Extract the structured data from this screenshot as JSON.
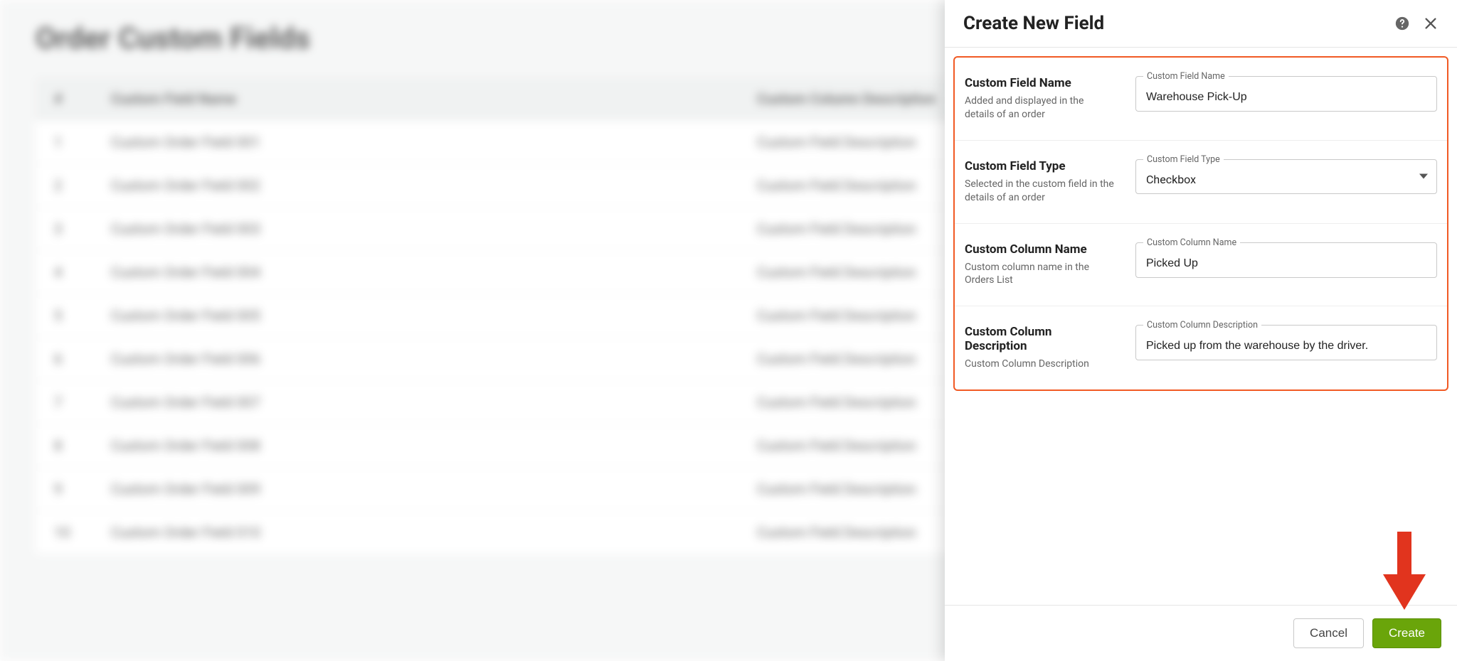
{
  "page": {
    "title": "Order Custom Fields",
    "columns": {
      "num": "#",
      "name": "Custom Field Name",
      "desc": "Custom Column Description"
    },
    "rows": [
      {
        "n": "1",
        "name": "Custom Order Field 001",
        "desc": "Custom Field Description"
      },
      {
        "n": "2",
        "name": "Custom Order Field 002",
        "desc": "Custom Field Description"
      },
      {
        "n": "3",
        "name": "Custom Order Field 003",
        "desc": "Custom Field Description"
      },
      {
        "n": "4",
        "name": "Custom Order Field 004",
        "desc": "Custom Field Description"
      },
      {
        "n": "5",
        "name": "Custom Order Field 005",
        "desc": "Custom Field Description"
      },
      {
        "n": "6",
        "name": "Custom Order Field 006",
        "desc": "Custom Field Description"
      },
      {
        "n": "7",
        "name": "Custom Order Field 007",
        "desc": "Custom Field Description"
      },
      {
        "n": "8",
        "name": "Custom Order Field 008",
        "desc": "Custom Field Description"
      },
      {
        "n": "9",
        "name": "Custom Order Field 009",
        "desc": "Custom Field Description"
      },
      {
        "n": "10",
        "name": "Custom Order Field 010",
        "desc": "Custom Field Description"
      }
    ]
  },
  "drawer": {
    "title": "Create New Field",
    "sections": {
      "field_name": {
        "title": "Custom Field Name",
        "desc": "Added and displayed in the details of an order",
        "input_label": "Custom Field Name",
        "value": "Warehouse Pick-Up"
      },
      "field_type": {
        "title": "Custom Field Type",
        "desc": "Selected in the custom field in the details of an order",
        "input_label": "Custom Field Type",
        "value": "Checkbox"
      },
      "col_name": {
        "title": "Custom Column Name",
        "desc": "Custom column name in the Orders List",
        "input_label": "Custom Column Name",
        "value": "Picked Up"
      },
      "col_desc": {
        "title": "Custom Column Description",
        "desc": "Custom Column Description",
        "input_label": "Custom Column Description",
        "value": "Picked up from the warehouse by the driver."
      }
    },
    "footer": {
      "cancel": "Cancel",
      "create": "Create"
    }
  }
}
